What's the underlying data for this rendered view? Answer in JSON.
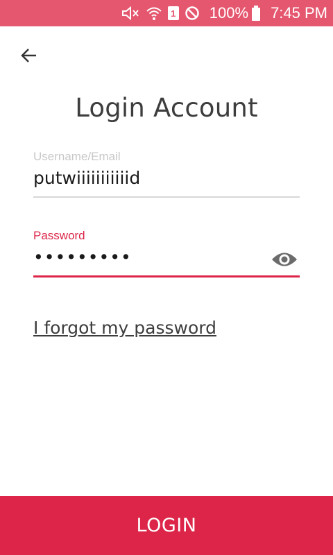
{
  "status_bar": {
    "battery_percent": "100%",
    "time": "7:45 PM",
    "sim_slot": "1",
    "icons": [
      "mute-icon",
      "wifi-icon",
      "sim-icon",
      "do-not-disturb-icon",
      "battery-icon"
    ],
    "background_color": "#e5576f"
  },
  "header": {
    "back_icon": "arrow-left-icon",
    "title": "Login Account"
  },
  "form": {
    "username": {
      "label": "Username/Email",
      "value": "putwiiiiiiiiiiid"
    },
    "password": {
      "label": "Password",
      "value": "•••••••••",
      "visibility_icon": "eye-icon"
    },
    "forgot_password_link": "I forgot my password"
  },
  "actions": {
    "login_label": "LOGIN"
  },
  "colors": {
    "accent": "#dc2548",
    "text": "#3d3d3d"
  }
}
